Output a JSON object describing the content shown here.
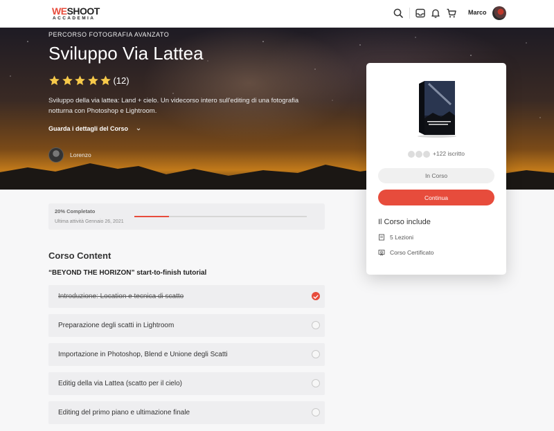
{
  "header": {
    "logo_main": "WESHOOT",
    "logo_sub": "ACCADEMIA",
    "user_name": "Marco",
    "icons": [
      "search-icon",
      "inbox-icon",
      "bell-icon",
      "cart-icon"
    ]
  },
  "hero": {
    "kicker": "PERCORSO FOTOGRAFIA AVANZATO",
    "title": "Sviluppo Via Lattea",
    "rating_stars": 5,
    "rating_count": "(12)",
    "description": "Sviluppo della via lattea: Land + cielo. Un videcorso intero sull'editing di una fotografia notturna con Photoshop e Lightroom.",
    "details_link": "Guarda i dettagli del Corso",
    "author": "Lorenzo"
  },
  "progress": {
    "label": "20% Completato",
    "last_activity": "Ultima attività Gennaio 26, 2021",
    "fraction": 0.2
  },
  "content": {
    "section_title": "Corso Content",
    "tutorial_title": "“BEYOND THE HORIZON” start-to-finish tutorial",
    "lessons": [
      {
        "label": "Introduzione: Location e tecnica di scatto",
        "completed": true
      },
      {
        "label": "Preparazione degli scatti in Lightroom",
        "completed": false
      },
      {
        "label": "Importazione in Photoshop, Blend e Unione degli Scatti",
        "completed": false
      },
      {
        "label": "Editig della via Lattea (scatto per il cielo)",
        "completed": false
      },
      {
        "label": "Editing del primo piano e ultimazione finale",
        "completed": false
      }
    ]
  },
  "sidebar": {
    "enrolled": "+122 iscritto",
    "status_button": "In Corso",
    "continue_button": "Continua",
    "includes_title": "Il Corso include",
    "includes": [
      {
        "icon": "book-icon",
        "label": "5 Lezioni"
      },
      {
        "icon": "certificate-icon",
        "label": "Corso Certificato"
      }
    ]
  },
  "colors": {
    "accent": "#e74c3c",
    "hero_dark": "#1e1b24",
    "hero_glow": "#c27a1a"
  }
}
